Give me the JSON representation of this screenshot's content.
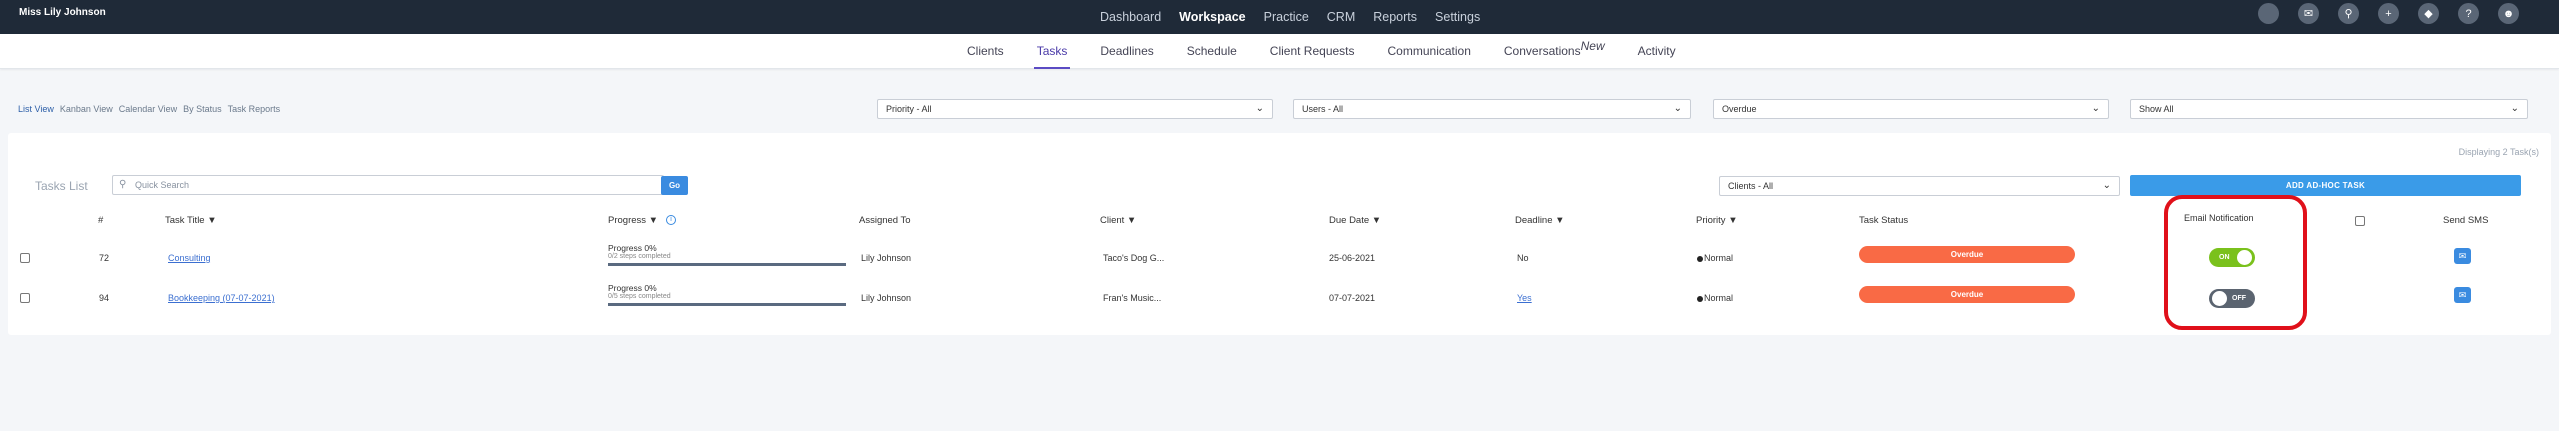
{
  "header": {
    "user_name": "Miss Lily Johnson",
    "nav": [
      "Dashboard",
      "Workspace",
      "Practice",
      "CRM",
      "Reports",
      "Settings"
    ],
    "icons": [
      "avatar-circle-icon",
      "megaphone-icon",
      "search-icon",
      "plus-icon",
      "tag-icon",
      "help-icon",
      "user-icon"
    ]
  },
  "subnav": {
    "items": [
      "Clients",
      "Tasks",
      "Deadlines",
      "Schedule",
      "Client Requests",
      "Communication",
      "Conversations",
      "Activity"
    ],
    "new_badge": "New"
  },
  "views": [
    "List View",
    "Kanban View",
    "Calendar View",
    "By Status",
    "Task Reports"
  ],
  "filters": {
    "priority": "Priority - All",
    "users": "Users - All",
    "overdue": "Overdue",
    "show": "Show All"
  },
  "tasks": {
    "displaying": "Displaying 2 Task(s)",
    "list_label": "Tasks List",
    "search_placeholder": "Quick Search",
    "go_label": "Go",
    "clients_filter": "Clients - All",
    "add_button": "ADD AD-HOC TASK",
    "columns": {
      "num": "#",
      "title": "Task Title ▼",
      "progress": "Progress ▼",
      "assigned": "Assigned To",
      "client": "Client ▼",
      "due": "Due Date ▼",
      "deadline": "Deadline ▼",
      "priority": "Priority ▼",
      "status": "Task Status",
      "email": "Email Notification",
      "sms": "Send SMS"
    },
    "rows": [
      {
        "num": "72",
        "title": "Consulting",
        "progress": "Progress 0%",
        "progress_sub": "0/2 steps completed",
        "assigned": "Lily Johnson",
        "client": "Taco's Dog G...",
        "due": "25-06-2021",
        "deadline": "No",
        "priority": "Normal",
        "status": "Overdue",
        "email_toggle": "ON"
      },
      {
        "num": "94",
        "title": "Bookkeeping (07-07-2021)",
        "progress": "Progress 0%",
        "progress_sub": "0/5 steps completed",
        "assigned": "Lily Johnson",
        "client": "Fran's Music...",
        "due": "07-07-2021",
        "deadline": "Yes",
        "priority": "Normal",
        "status": "Overdue",
        "email_toggle": "OFF"
      }
    ]
  },
  "colors": {
    "topbar": "#1f2a38",
    "accent": "#3a8be0",
    "overdue": "#f96a45",
    "toggle_on": "#7ac11c",
    "toggle_off": "#5b6470",
    "highlight": "#e0101a"
  }
}
